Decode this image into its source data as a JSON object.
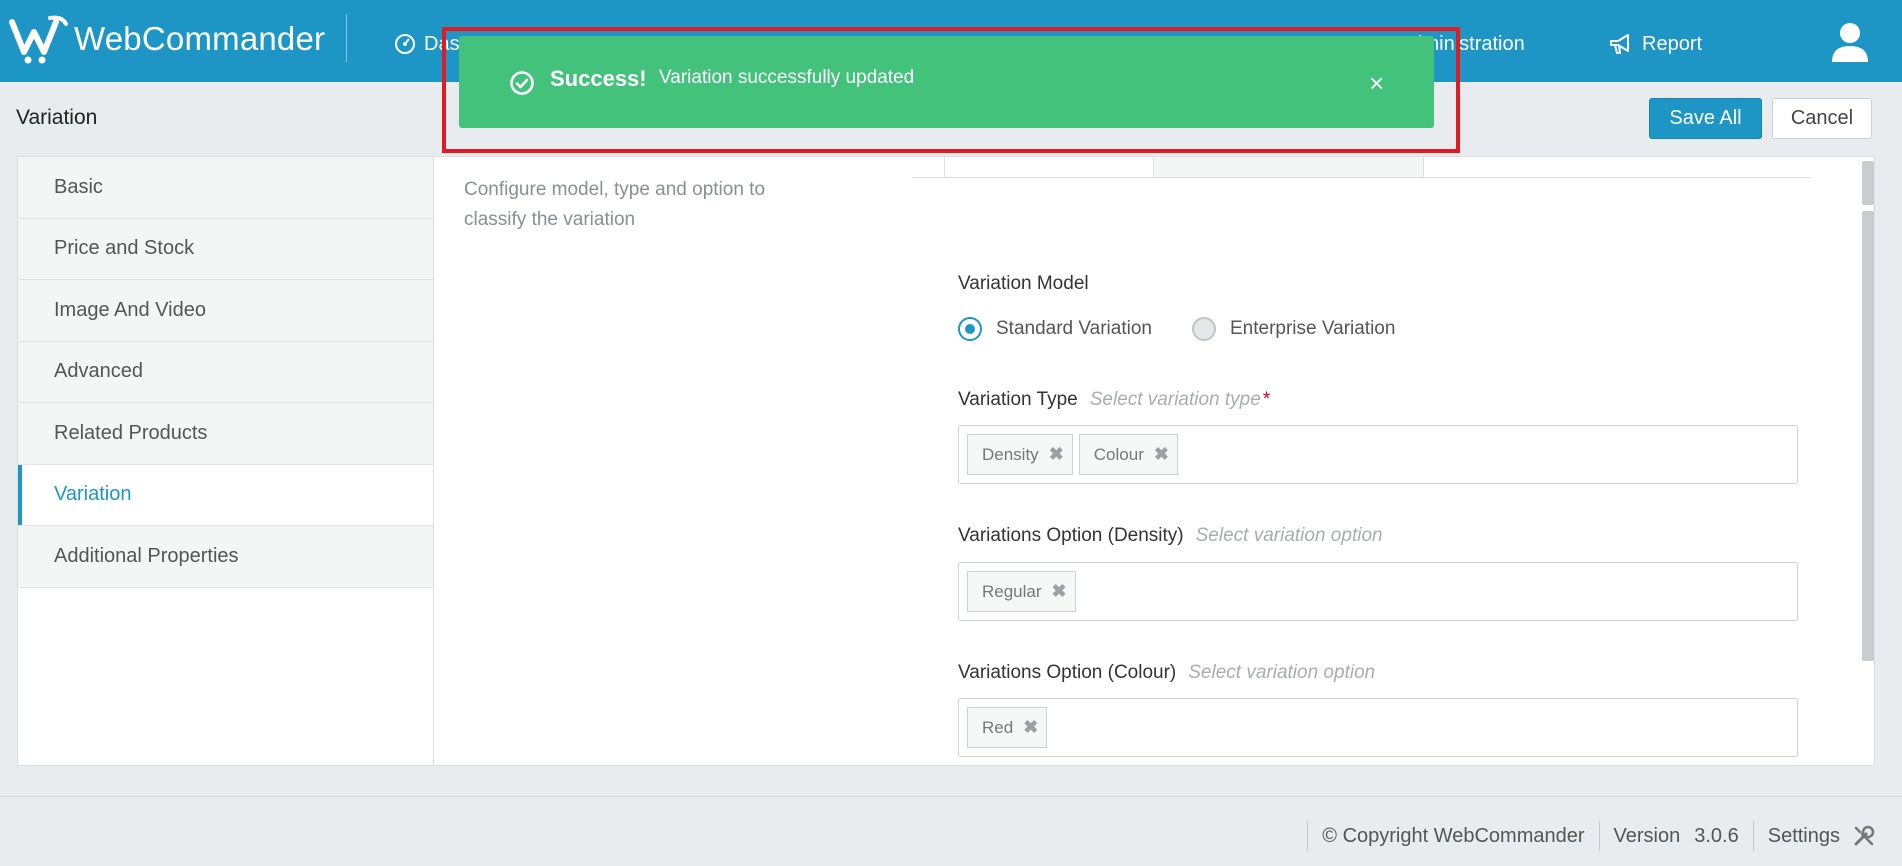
{
  "app": {
    "name": "WebCommander",
    "nav": {
      "dashboard": "Das",
      "administration": "Administration",
      "report": "Report"
    }
  },
  "page": {
    "title": "Variation",
    "save_label": "Save All",
    "cancel_label": "Cancel"
  },
  "sidebar": {
    "items": [
      {
        "label": "Basic",
        "active": false
      },
      {
        "label": "Price and Stock",
        "active": false
      },
      {
        "label": "Image And Video",
        "active": false
      },
      {
        "label": "Advanced",
        "active": false
      },
      {
        "label": "Related Products",
        "active": false
      },
      {
        "label": "Variation",
        "active": true
      },
      {
        "label": "Additional Properties",
        "active": false
      }
    ]
  },
  "main": {
    "description": "Configure model, type and option to classify the variation",
    "variation_model": {
      "label": "Variation Model",
      "options": [
        "Standard Variation",
        "Enterprise Variation"
      ],
      "selected": "Standard Variation"
    },
    "variation_type": {
      "label": "Variation Type",
      "hint": "Select variation type",
      "required_mark": "*",
      "tags": [
        "Density",
        "Colour"
      ]
    },
    "option_density": {
      "label": "Variations Option (Density)",
      "hint": "Select variation option",
      "tags": [
        "Regular"
      ]
    },
    "option_colour": {
      "label": "Variations Option (Colour)",
      "hint": "Select variation option",
      "tags": [
        "Red"
      ]
    }
  },
  "toast": {
    "title": "Success!",
    "message": "Variation successfully updated",
    "close": "×"
  },
  "footer": {
    "copyright": "© Copyright WebCommander",
    "version_label": "Version",
    "version_number": "3.0.6",
    "settings": "Settings"
  },
  "colors": {
    "brand": "#1d96c6",
    "toast_success": "#42c27b",
    "highlight_frame": "#e01b24",
    "required": "#d0021b"
  },
  "icons": {
    "dashboard": "dashboard-icon",
    "administration": "administration-icon",
    "report": "megaphone-icon",
    "user": "user-icon",
    "success": "check-circle-icon",
    "settings": "wrench-icon"
  }
}
